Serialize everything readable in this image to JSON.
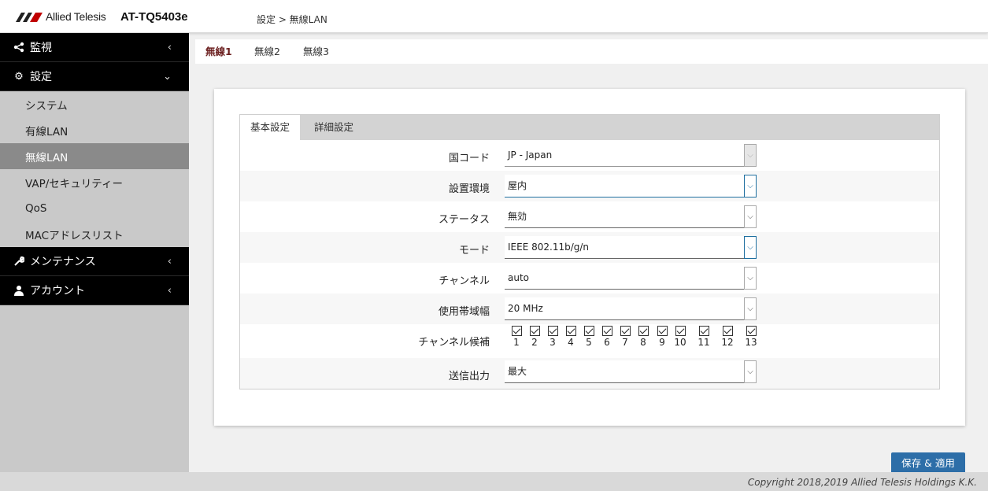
{
  "header": {
    "brand": "Allied Telesis",
    "model": "AT-TQ5403e",
    "breadcrumb": "設定 > 無線LAN"
  },
  "sidebar": {
    "items": [
      {
        "label": "監視",
        "icon": "share-icon",
        "chevron": "‹"
      },
      {
        "label": "設定",
        "icon": "gear-icon",
        "chevron": "⌄"
      },
      {
        "label": "メンテナンス",
        "icon": "wrench-icon",
        "chevron": "‹"
      },
      {
        "label": "アカウント",
        "icon": "user-icon",
        "chevron": "‹"
      }
    ],
    "sub_items": [
      {
        "label": "システム",
        "active": false
      },
      {
        "label": "有線LAN",
        "active": false
      },
      {
        "label": "無線LAN",
        "active": true
      },
      {
        "label": "VAP/セキュリティー",
        "active": false
      },
      {
        "label": "QoS",
        "active": false
      },
      {
        "label": "MACアドレスリスト",
        "active": false
      }
    ]
  },
  "radio_tabs": [
    "無線1",
    "無線2",
    "無線3"
  ],
  "sub_tabs": [
    "基本設定",
    "詳細設定"
  ],
  "form": {
    "country": {
      "label": "国コード",
      "value": "JP - Japan"
    },
    "environment": {
      "label": "設置環境",
      "value": "屋内"
    },
    "status": {
      "label": "ステータス",
      "value": "無効"
    },
    "mode": {
      "label": "モード",
      "value": "IEEE 802.11b/g/n"
    },
    "channel": {
      "label": "チャンネル",
      "value": "auto"
    },
    "bandwidth": {
      "label": "使用帯域幅",
      "value": "20 MHz"
    },
    "channel_candidates": {
      "label": "チャンネル候補",
      "values": [
        "1",
        "2",
        "3",
        "4",
        "5",
        "6",
        "7",
        "8",
        "9",
        "10",
        "11",
        "12",
        "13"
      ]
    },
    "tx_power": {
      "label": "送信出力",
      "value": "最大"
    }
  },
  "save_label": "保存 & 適用",
  "copyright": "Copyright 2018,2019 Allied Telesis Holdings K.K.",
  "colors": {
    "accent": "#2d6ea8",
    "active_tab": "#6b1f1f",
    "sidebar_bg": "#c9c9c9",
    "nav_bg": "#000000"
  }
}
